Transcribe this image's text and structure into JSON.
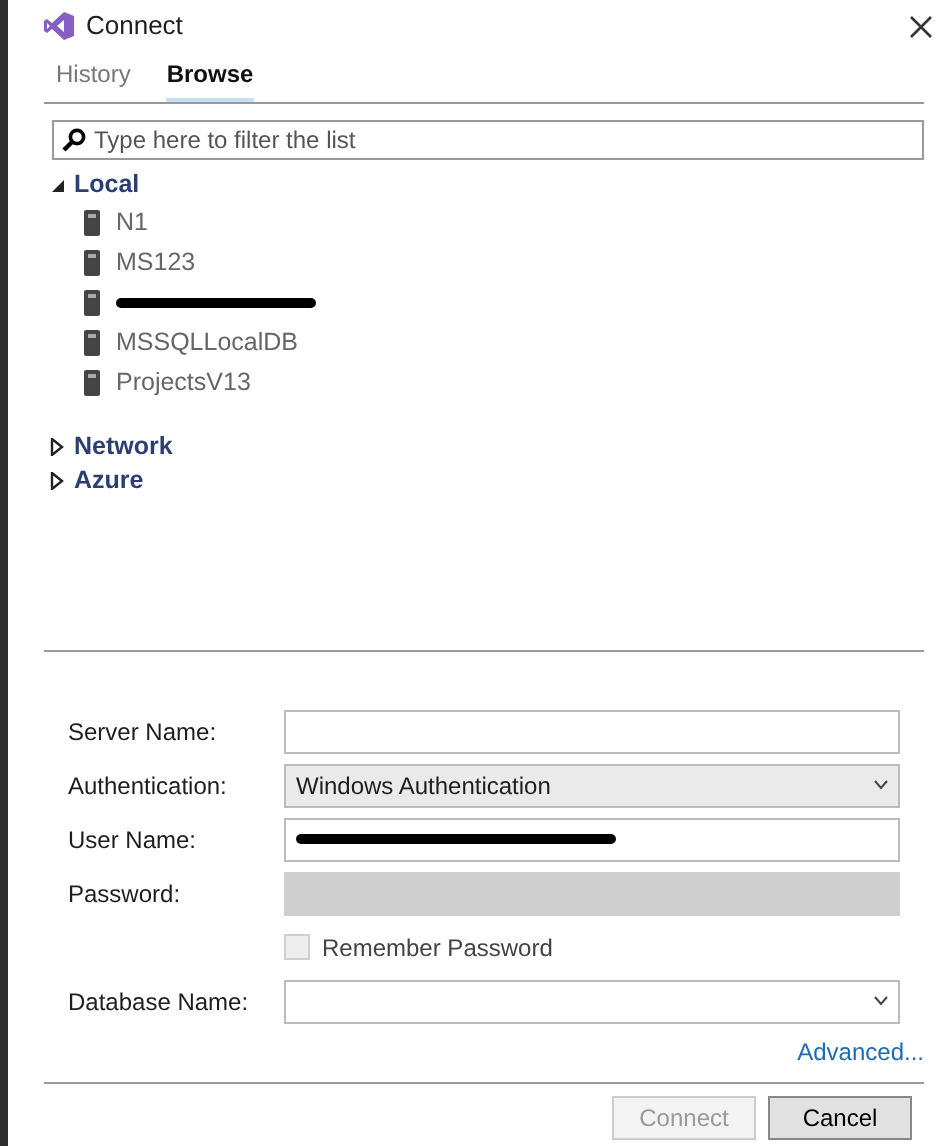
{
  "window": {
    "title": "Connect"
  },
  "tabs": [
    {
      "label": "History",
      "selected": false
    },
    {
      "label": "Browse",
      "selected": true
    }
  ],
  "filter": {
    "placeholder": "Type here to filter the list"
  },
  "tree": [
    {
      "label": "Local",
      "expanded": true,
      "children": [
        {
          "name": "N1",
          "redacted": false
        },
        {
          "name": "MS123",
          "redacted": false
        },
        {
          "redacted": true
        },
        {
          "name": "MSSQLLocalDB",
          "redacted": false
        },
        {
          "name": "ProjectsV13",
          "redacted": false
        }
      ]
    },
    {
      "label": "Network",
      "expanded": false
    },
    {
      "label": "Azure",
      "expanded": false
    }
  ],
  "form": [
    {
      "kind": "text",
      "label": "Server Name:",
      "disabled": false
    },
    {
      "kind": "select",
      "label": "Authentication:",
      "value": "Windows Authentication"
    },
    {
      "kind": "text",
      "label": "User Name:",
      "redacted": true,
      "disabled": false
    },
    {
      "kind": "text",
      "label": "Password:",
      "disabled": true
    },
    {
      "kind": "checkbox",
      "label": "Remember Password",
      "checked": false,
      "disabled": true
    },
    {
      "kind": "combo",
      "label": "Database Name:"
    }
  ],
  "advanced_link": "Advanced...",
  "buttons": [
    {
      "label": "Connect",
      "disabled": true
    },
    {
      "label": "Cancel",
      "disabled": false
    }
  ]
}
